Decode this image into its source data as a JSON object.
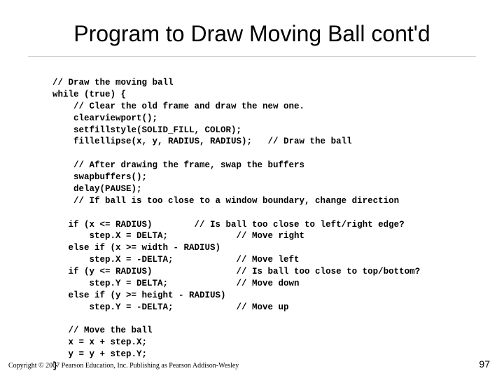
{
  "title": "Program to Draw Moving Ball cont'd",
  "code": "// Draw the moving ball\nwhile (true) {\n    // Clear the old frame and draw the new one.\n    clearviewport();\n    setfillstyle(SOLID_FILL, COLOR);\n    fillellipse(x, y, RADIUS, RADIUS);   // Draw the ball\n\n    // After drawing the frame, swap the buffers\n    swapbuffers();\n    delay(PAUSE);\n    // If ball is too close to a window boundary, change direction\n\n   if (x <= RADIUS)        // Is ball too close to left/right edge?\n       step.X = DELTA;             // Move right\n   else if (x >= width - RADIUS)\n       step.X = -DELTA;            // Move left\n   if (y <= RADIUS)                // Is ball too close to top/bottom?\n       step.Y = DELTA;             // Move down\n   else if (y >= height - RADIUS)\n       step.Y = -DELTA;            // Move up\n\n   // Move the ball\n   x = x + step.X;\n   y = y + step.Y;\n}",
  "footer": {
    "copyright": "Copyright © 2007 Pearson Education, Inc. Publishing as Pearson Addison-Wesley",
    "page_number": "97"
  }
}
